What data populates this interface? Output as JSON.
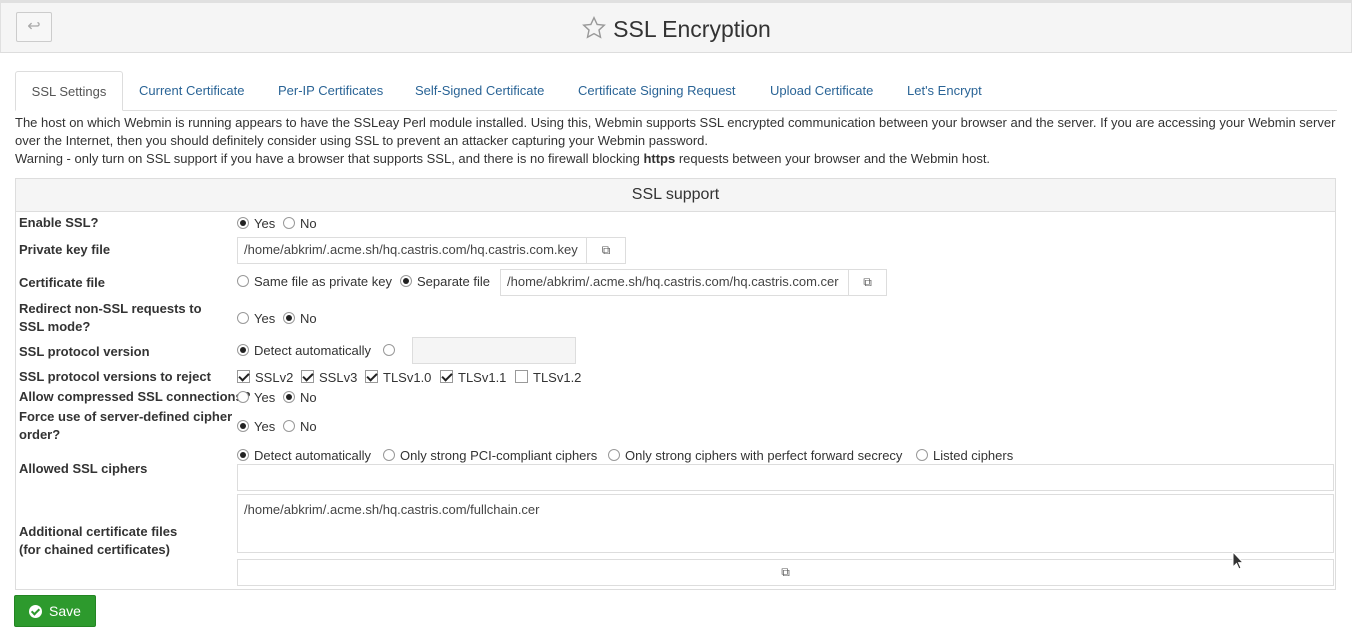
{
  "header": {
    "title": "SSL Encryption",
    "back_icon": "back-arrow-icon",
    "star_icon": "star-icon"
  },
  "tabs": [
    {
      "label": "SSL Settings",
      "active": true
    },
    {
      "label": "Current Certificate"
    },
    {
      "label": "Per-IP Certificates"
    },
    {
      "label": "Self-Signed Certificate"
    },
    {
      "label": "Certificate Signing Request"
    },
    {
      "label": "Upload Certificate"
    },
    {
      "label": "Let's Encrypt"
    }
  ],
  "intro": {
    "line1": "The host on which Webmin is running appears to have the SSLeay Perl module installed. Using this, Webmin supports SSL encrypted communication between your browser and the server. If you are accessing your Webmin server over the Internet, then you should definitely consider using SSL to prevent an attacker capturing your Webmin password.",
    "warn_pre": "Warning - only turn on SSL support if you have a browser that supports SSL, and there is no firewall blocking ",
    "warn_bold": "https",
    "warn_post": " requests between your browser and the Webmin host."
  },
  "panel": {
    "title": "SSL support",
    "enable_ssl": {
      "label": "Enable SSL?",
      "yes": "Yes",
      "no": "No",
      "selected": "Yes"
    },
    "private_key": {
      "label": "Private key file",
      "value": "/home/abkrim/.acme.sh/hq.castris.com/hq.castris.com.key"
    },
    "cert_file": {
      "label": "Certificate file",
      "opt_same": "Same file as private key",
      "opt_separate": "Separate file",
      "selected": "Separate file",
      "value": "/home/abkrim/.acme.sh/hq.castris.com/hq.castris.com.cer"
    },
    "redirect": {
      "label": "Redirect non-SSL requests to SSL mode?",
      "yes": "Yes",
      "no": "No",
      "selected": "No"
    },
    "protocol_version": {
      "label": "SSL protocol version",
      "opt_auto": "Detect automatically",
      "selected": "Detect automatically",
      "value": ""
    },
    "reject_versions": {
      "label": "SSL protocol versions to reject",
      "options": [
        {
          "label": "SSLv2",
          "checked": true
        },
        {
          "label": "SSLv3",
          "checked": true
        },
        {
          "label": "TLSv1.0",
          "checked": true
        },
        {
          "label": "TLSv1.1",
          "checked": true
        },
        {
          "label": "TLSv1.2",
          "checked": false
        }
      ]
    },
    "compressed": {
      "label": "Allow compressed SSL connections?",
      "yes": "Yes",
      "no": "No",
      "selected": "No"
    },
    "cipher_order": {
      "label": "Force use of server-defined cipher order?",
      "yes": "Yes",
      "no": "No",
      "selected": "Yes"
    },
    "ciphers": {
      "label": "Allowed SSL ciphers",
      "opt_auto": "Detect automatically",
      "opt_pci": "Only strong PCI-compliant ciphers",
      "opt_pfs": "Only strong ciphers with perfect forward secrecy",
      "opt_listed": "Listed ciphers",
      "selected": "Detect automatically",
      "value": ""
    },
    "extra_certs": {
      "label_line1": "Additional certificate files",
      "label_line2": "(for chained certificates)",
      "value": "/home/abkrim/.acme.sh/hq.castris.com/fullchain.cer"
    }
  },
  "save": {
    "label": "Save",
    "icon": "check-circle-icon"
  },
  "colors": {
    "accent": "#2a6496",
    "save_green": "#2d9a2d"
  }
}
